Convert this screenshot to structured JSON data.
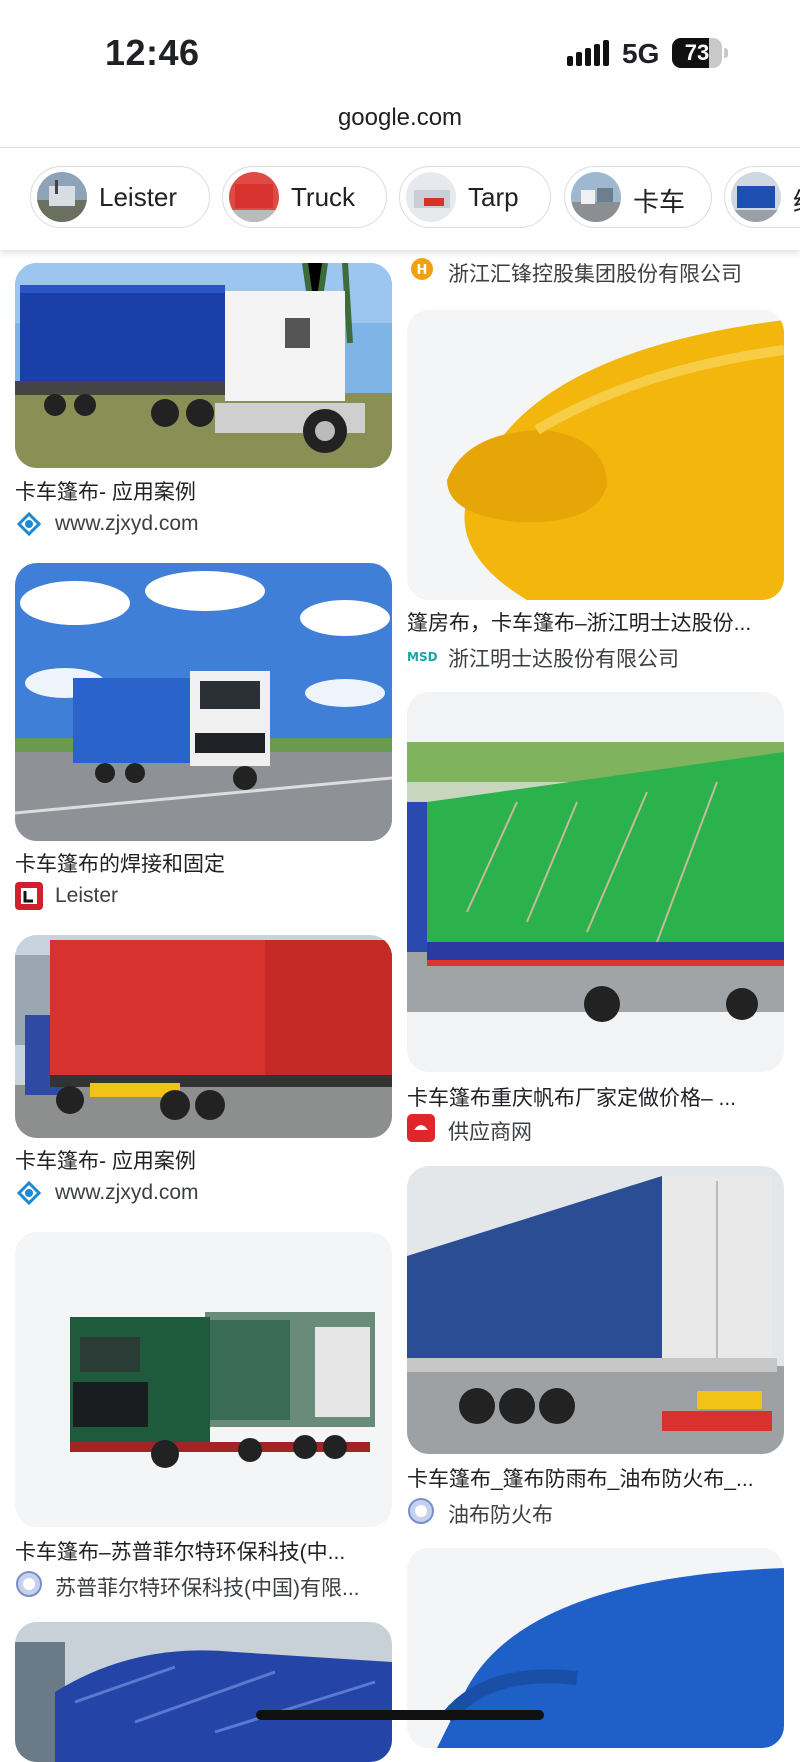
{
  "status_bar": {
    "time": "12:46",
    "network": "5G",
    "battery": "73",
    "battery_level": 0.73
  },
  "browser": {
    "url": "google.com"
  },
  "chips": [
    {
      "label": "Leister",
      "icon": "truck-thumbnail"
    },
    {
      "label": "Truck",
      "icon": "red-truck-thumbnail"
    },
    {
      "label": "Tarp",
      "icon": "tarp-thumbnail"
    },
    {
      "label": "卡车",
      "icon": "truck-road-thumbnail"
    },
    {
      "label": "绿",
      "icon": "blue-truck-thumbnail"
    }
  ],
  "left_results": [
    {
      "title": "卡车篷布- 应用案例",
      "source": "www.zjxyd.com",
      "favicon": "zjxyd-logo-icon"
    },
    {
      "title": "卡车篷布的焊接和固定",
      "source": "Leister",
      "favicon": "leister-logo-icon"
    },
    {
      "title": "卡车篷布- 应用案例",
      "source": "www.zjxyd.com",
      "favicon": "zjxyd-logo-icon"
    },
    {
      "title": "卡车篷布–苏普菲尔特环保科技(中...",
      "source": "苏普菲尔特环保科技(中国)有限...",
      "favicon": "globe-icon"
    }
  ],
  "right_results": [
    {
      "title": "",
      "source": "浙江汇锋控股集团股份有限公司",
      "favicon": "huifeng-logo-icon"
    },
    {
      "title": "篷房布，卡车篷布–浙江明士达股份...",
      "source": "浙江明士达股份有限公司",
      "favicon": "msd-logo-icon"
    },
    {
      "title": "卡车篷布重庆帆布厂家定做价格– ...",
      "source": "供应商网",
      "favicon": "gongying-logo-icon"
    },
    {
      "title": "卡车篷布_篷布防雨布_油布防火布_...",
      "source": "油布防火布",
      "favicon": "globe-icon"
    }
  ],
  "colors": {
    "accent_blue": "#1a3fa8",
    "truck_red": "#d8322e",
    "tarp_yellow": "#f2b60c",
    "tarp_green": "#2bb24c"
  }
}
